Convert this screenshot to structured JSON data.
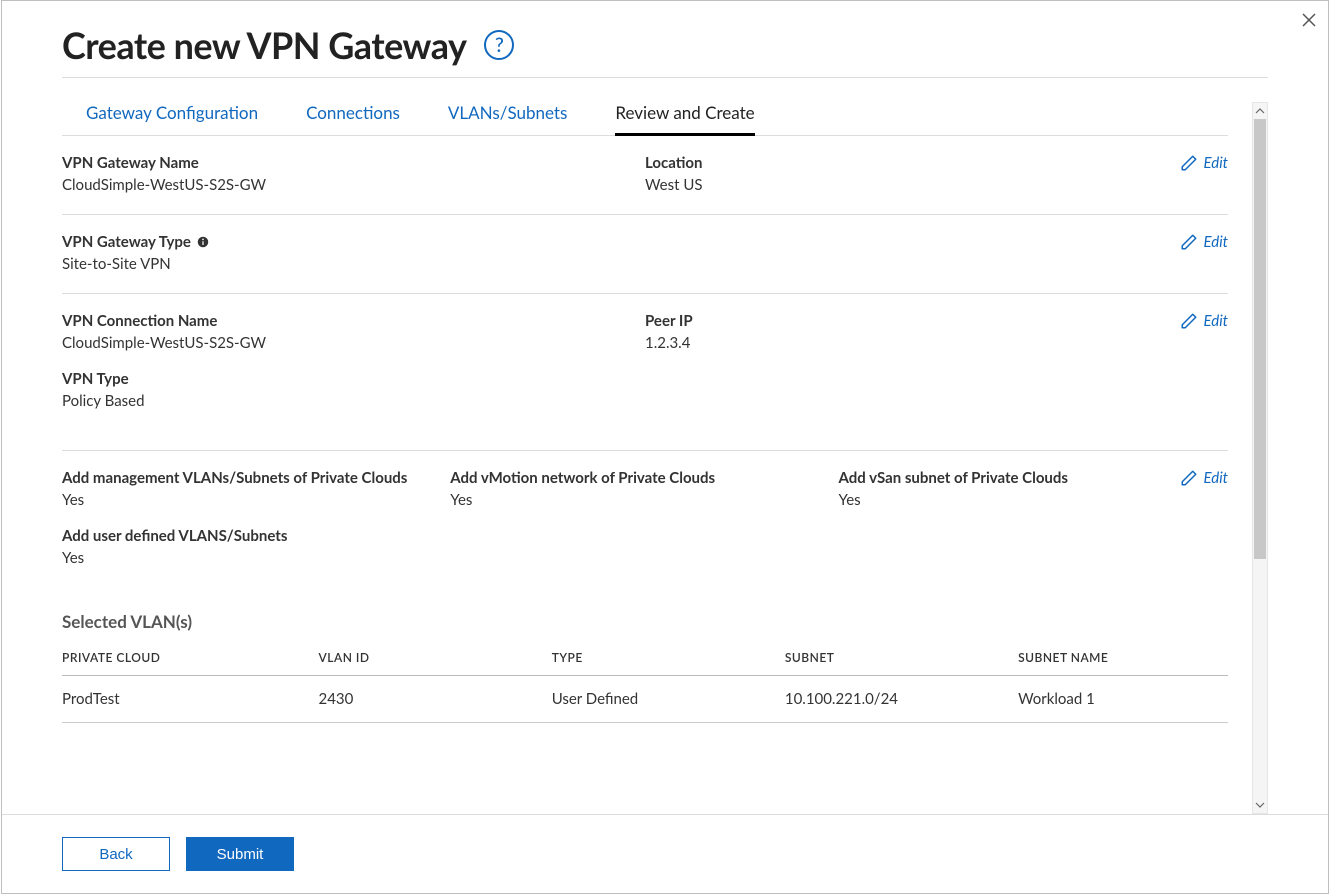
{
  "header": {
    "title": "Create new VPN Gateway"
  },
  "actions": {
    "edit_label": "Edit",
    "back_label": "Back",
    "submit_label": "Submit"
  },
  "tabs": [
    {
      "label": "Gateway Configuration",
      "active": false
    },
    {
      "label": "Connections",
      "active": false
    },
    {
      "label": "VLANs/Subnets",
      "active": false
    },
    {
      "label": "Review and Create",
      "active": true
    }
  ],
  "gateway_section": {
    "name_label": "VPN Gateway Name",
    "name_value": "CloudSimple-WestUS-S2S-GW",
    "location_label": "Location",
    "location_value": "West US"
  },
  "type_section": {
    "type_label": "VPN Gateway Type",
    "type_value": "Site-to-Site VPN"
  },
  "connection_section": {
    "conn_name_label": "VPN Connection Name",
    "conn_name_value": "CloudSimple-WestUS-S2S-GW",
    "peer_ip_label": "Peer IP",
    "peer_ip_value": "1.2.3.4",
    "vpn_type_label": "VPN Type",
    "vpn_type_value": "Policy Based"
  },
  "vlans_section": {
    "mgmt_label": "Add management VLANs/Subnets of Private Clouds",
    "mgmt_value": "Yes",
    "vmotion_label": "Add vMotion network of Private Clouds",
    "vmotion_value": "Yes",
    "vsan_label": "Add vSan subnet of Private Clouds",
    "vsan_value": "Yes",
    "user_label": "Add user defined VLANS/Subnets",
    "user_value": "Yes"
  },
  "vlan_table": {
    "title": "Selected VLAN(s)",
    "columns": {
      "pc": "PRIVATE CLOUD",
      "vlan_id": "VLAN ID",
      "type": "TYPE",
      "subnet": "SUBNET",
      "subnet_name": "SUBNET NAME"
    },
    "rows": [
      {
        "pc": "ProdTest",
        "vlan_id": "2430",
        "type": "User Defined",
        "subnet": "10.100.221.0/24",
        "subnet_name": "Workload 1"
      }
    ]
  }
}
